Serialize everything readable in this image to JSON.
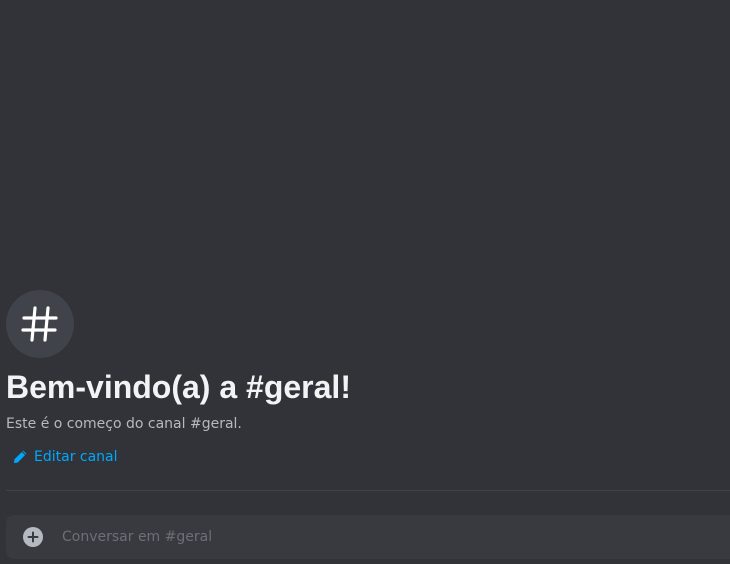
{
  "channel": {
    "icon": "hashtag-icon",
    "welcome_title": "Bem-vindo(a) a #geral!",
    "welcome_description": "Este é o começo do canal #geral.",
    "edit_label": "Editar canal"
  },
  "composer": {
    "placeholder": "Conversar em #geral",
    "value": "",
    "attach_icon": "plus-circle-icon"
  },
  "colors": {
    "background": "#313338",
    "icon_circle": "#41434a",
    "link": "#00a8fc",
    "composer_bg": "#383a40"
  }
}
